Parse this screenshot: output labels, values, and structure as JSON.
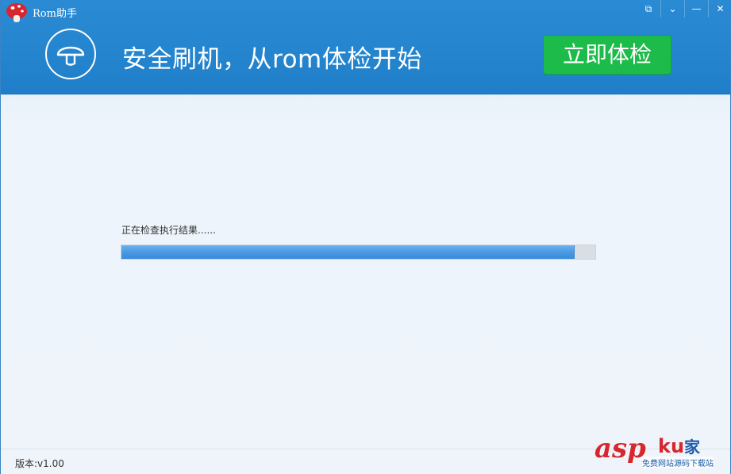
{
  "window": {
    "title": "Rom助手",
    "controls": [
      {
        "name": "feedback-button",
        "icon": "feedback-icon",
        "glyph": "⧉"
      },
      {
        "name": "menu-button",
        "icon": "chevron-down-icon",
        "glyph": "⌄"
      },
      {
        "name": "minimize-button",
        "icon": "minimize-icon",
        "glyph": "—"
      },
      {
        "name": "close-button",
        "icon": "close-icon",
        "glyph": "✕"
      }
    ]
  },
  "header": {
    "headline": "安全刷机，从rom体检开始",
    "check_button_label": "立即体检",
    "logo_icon": "mushroom-icon"
  },
  "main": {
    "status_text": "正在检查执行结果......",
    "progress": 0.955
  },
  "footer": {
    "version": "版本:v1.00"
  },
  "watermark": {
    "brand": "asp",
    "brand_suffix": "ku",
    "cn": "家",
    "tagline": "免费网站源码下载站"
  },
  "colors": {
    "titlebar": "#2586cf",
    "check_button": "#1dbb49",
    "progress_fill": "#4a99e4",
    "progress_track": "#d9dee4"
  }
}
